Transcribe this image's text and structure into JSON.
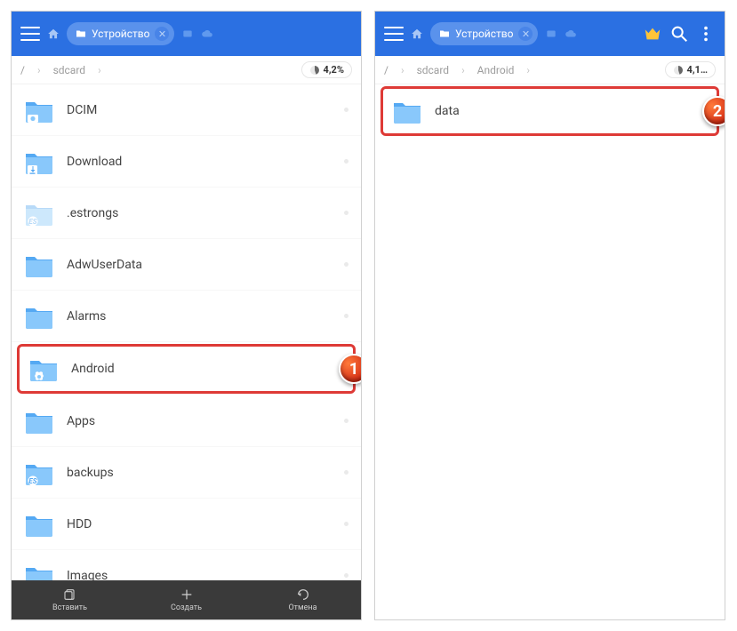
{
  "panes": [
    {
      "tab_label": "Устройство",
      "show_right_actions": false,
      "breadcrumbs": [
        "/",
        "sdcard"
      ],
      "storage": "4,2%",
      "files": [
        {
          "name": "DCIM",
          "icon": "camera"
        },
        {
          "name": "Download",
          "icon": "download"
        },
        {
          "name": ".estrongs",
          "icon": "badge-faded"
        },
        {
          "name": "AdwUserData",
          "icon": "plain"
        },
        {
          "name": "Alarms",
          "icon": "plain"
        },
        {
          "name": "Android",
          "icon": "gear",
          "highlight": true,
          "marker": "1"
        },
        {
          "name": "Apps",
          "icon": "plain"
        },
        {
          "name": "backups",
          "icon": "badge"
        },
        {
          "name": "HDD",
          "icon": "plain"
        },
        {
          "name": "Images",
          "icon": "plain"
        }
      ],
      "bottom": [
        {
          "label": "Вставить",
          "icon": "paste"
        },
        {
          "label": "Создать",
          "icon": "plus"
        },
        {
          "label": "Отмена",
          "icon": "undo"
        }
      ]
    },
    {
      "tab_label": "Устройство",
      "show_right_actions": true,
      "breadcrumbs": [
        "/",
        "sdcard",
        "Android"
      ],
      "storage": "4,1…",
      "files": [
        {
          "name": "data",
          "icon": "plain",
          "highlight": true,
          "marker": "2"
        }
      ]
    }
  ]
}
